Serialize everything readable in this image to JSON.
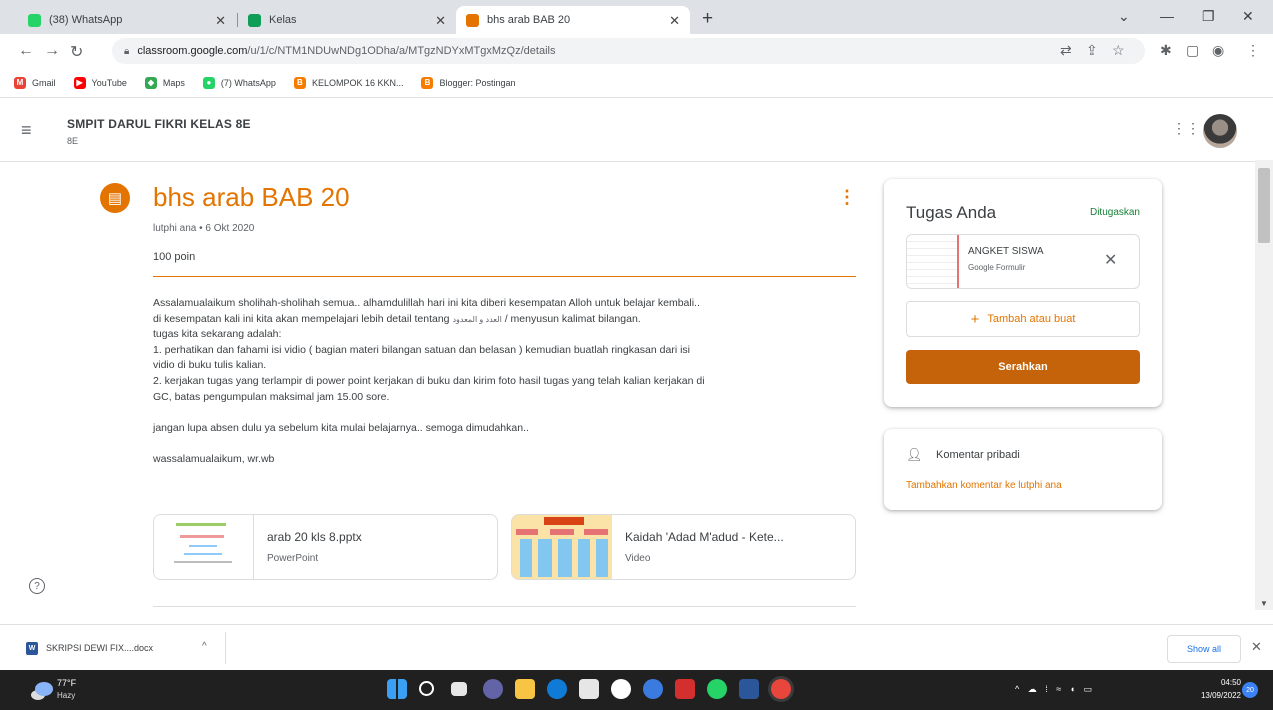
{
  "browser": {
    "tabs": [
      {
        "title": "(38) WhatsApp",
        "color": "#25d366"
      },
      {
        "title": "Kelas",
        "color": "#0f9d58"
      },
      {
        "title": "bhs arab BAB 20",
        "color": "#e37400"
      }
    ],
    "url_host": "classroom.google.com",
    "url_path": "/u/1/c/NTM1NDUwNDg1ODha/a/MTgzNDYxMTgxMzQz/details",
    "bookmarks": [
      {
        "label": "Gmail",
        "icon": "gmail-icon",
        "color": "#ea4335",
        "glyph": "M"
      },
      {
        "label": "YouTube",
        "icon": "youtube-icon",
        "color": "#ff0000",
        "glyph": "▶"
      },
      {
        "label": "Maps",
        "icon": "maps-icon",
        "color": "#34a853",
        "glyph": "◆"
      },
      {
        "label": "(7) WhatsApp",
        "icon": "whatsapp-icon",
        "color": "#25d366",
        "glyph": "●"
      },
      {
        "label": "KELOMPOK 16 KKN...",
        "icon": "blogger-icon",
        "color": "#f57c00",
        "glyph": "B"
      },
      {
        "label": "Blogger: Postingan",
        "icon": "blogger-icon",
        "color": "#f57c00",
        "glyph": "B"
      }
    ]
  },
  "classroom": {
    "class_name": "SMPIT DARUL FIKRI KELAS 8E",
    "section": "8E"
  },
  "assignment": {
    "title": "bhs arab BAB 20",
    "meta": "lutphi ana • 6 Okt 2020",
    "points": "100 poin",
    "body": {
      "line1": "Assalamualaikum sholihah-sholihah semua.. alhamdulillah hari ini kita diberi kesempatan Alloh untuk belajar kembali..",
      "line2_a": "di kesempatan kali ini kita akan mempelajari lebih detail tentang",
      "line2_arabic": "العدد و المعدود",
      "line2_b": "/ menyusun kalimat bilangan.",
      "line3": "tugas kita sekarang adalah:",
      "line4": "1. perhatikan dan fahami isi vidio ( bagian materi bilangan satuan dan belasan ) kemudian buatlah ringkasan dari isi",
      "line5": "vidio di buku tulis kalian.",
      "line6": "2. kerjakan tugas yang terlampir di power point kerjakan di buku dan kirim foto hasil tugas yang telah kalian kerjakan di",
      "line7": "GC, batas pengumpulan maksimal jam 15.00 sore.",
      "line8": "jangan lupa absen dulu ya sebelum kita mulai belajarnya.. semoga dimudahkan..",
      "line9": "wassalamualaikum, wr.wb"
    },
    "attachments": [
      {
        "name": "arab 20 kls 8.pptx",
        "type": "PowerPoint"
      },
      {
        "name": "Kaidah 'Adad M'adud - Kete...",
        "type": "Video"
      }
    ]
  },
  "your_work": {
    "title": "Tugas Anda",
    "status": "Ditugaskan",
    "file_name": "ANGKET SISWA",
    "file_type": "Google Formulir",
    "add_label": "Tambah atau buat",
    "submit_label": "Serahkan"
  },
  "private_comments": {
    "title": "Komentar pribadi",
    "link": "Tambahkan komentar ke lutphi ana"
  },
  "download": {
    "file": "SKRIPSI DEWI FIX....docx",
    "show_all": "Show all"
  },
  "taskbar": {
    "temp": "77°F",
    "condition": "Hazy",
    "time": "04:50",
    "date": "13/09/2022",
    "notifications": "20"
  }
}
